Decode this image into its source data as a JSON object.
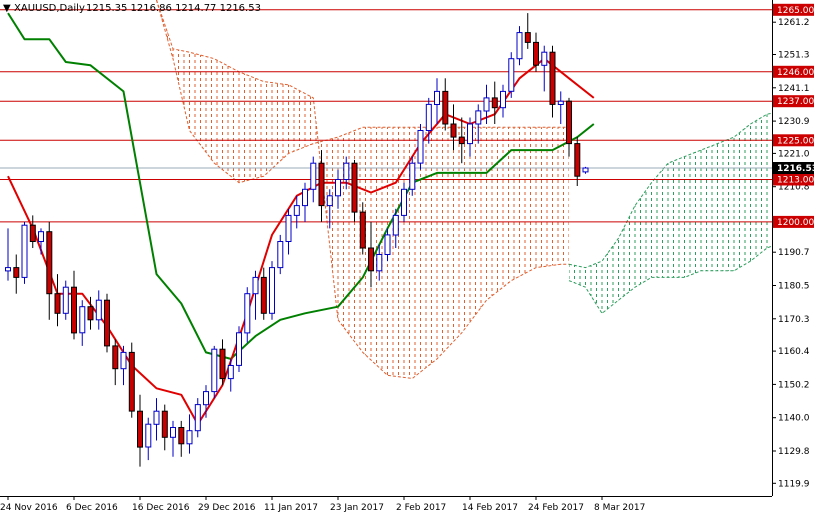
{
  "header": {
    "symbol": "XAUUSD,Daily",
    "ohlc": "1215.35 1216.86 1214.77 1216.53",
    "arrow": "▼"
  },
  "colors": {
    "bull_body": "#ffffff",
    "bull_border": "#0000c8",
    "bear_body": "#c80000",
    "bear_border": "#000000",
    "tenkan": "#e00000",
    "kijun": "#008000",
    "cloud_bear": "#e06030",
    "cloud_bull": "#2e9e5e",
    "level_line": "#cc0000",
    "level_label_bg": "#cc0000",
    "current_label_bg": "#000000"
  },
  "chart_data": {
    "type": "candlestick",
    "ylim": [
      1116,
      1268
    ],
    "grid": false,
    "yticks": [
      1261.2,
      1251.3,
      1241.1,
      1230.9,
      1221.0,
      1210.8,
      1200.6,
      1190.7,
      1180.5,
      1170.3,
      1160.4,
      1150.2,
      1140.0,
      1129.8,
      1119.9
    ],
    "xticks": [
      {
        "label": "24 Nov 2016",
        "i": 0
      },
      {
        "label": "6 Dec 2016",
        "i": 8
      },
      {
        "label": "16 Dec 2016",
        "i": 16
      },
      {
        "label": "29 Dec 2016",
        "i": 24
      },
      {
        "label": "11 Jan 2017",
        "i": 32
      },
      {
        "label": "23 Jan 2017",
        "i": 40
      },
      {
        "label": "2 Feb 2017",
        "i": 48
      },
      {
        "label": "14 Feb 2017",
        "i": 56
      },
      {
        "label": "24 Feb 2017",
        "i": 64
      },
      {
        "label": "8 Mar 2017",
        "i": 72
      }
    ],
    "levels": [
      {
        "value": 1265.0,
        "label": "1265.00"
      },
      {
        "value": 1246.0,
        "label": "1246.00"
      },
      {
        "value": 1237.0,
        "label": "1237.00"
      },
      {
        "value": 1225.0,
        "label": "1225.00"
      },
      {
        "value": 1213.0,
        "label": "1213.00"
      },
      {
        "value": 1200.0,
        "label": "1200.00"
      }
    ],
    "current_price": {
      "value": 1216.53,
      "label": "1216.53"
    },
    "candles": [
      [
        1185,
        1198,
        1182,
        1186
      ],
      [
        1186,
        1190,
        1178,
        1183
      ],
      [
        1183,
        1200,
        1181,
        1199
      ],
      [
        1199,
        1202,
        1192,
        1194
      ],
      [
        1194,
        1198,
        1190,
        1197
      ],
      [
        1197,
        1200,
        1170,
        1178
      ],
      [
        1178,
        1184,
        1168,
        1172
      ],
      [
        1172,
        1182,
        1170,
        1180
      ],
      [
        1180,
        1185,
        1164,
        1166
      ],
      [
        1166,
        1176,
        1162,
        1174
      ],
      [
        1174,
        1177,
        1167,
        1170
      ],
      [
        1170,
        1179,
        1167,
        1176
      ],
      [
        1176,
        1178,
        1160,
        1162
      ],
      [
        1162,
        1164,
        1150,
        1155
      ],
      [
        1155,
        1162,
        1150,
        1160
      ],
      [
        1160,
        1163,
        1140,
        1142
      ],
      [
        1142,
        1147,
        1125,
        1131
      ],
      [
        1131,
        1140,
        1127,
        1138
      ],
      [
        1138,
        1146,
        1133,
        1142
      ],
      [
        1142,
        1144,
        1130,
        1134
      ],
      [
        1134,
        1139,
        1128,
        1137
      ],
      [
        1137,
        1139,
        1128,
        1132
      ],
      [
        1132,
        1141,
        1129,
        1136
      ],
      [
        1136,
        1146,
        1134,
        1144
      ],
      [
        1144,
        1150,
        1140,
        1148
      ],
      [
        1148,
        1162,
        1146,
        1161
      ],
      [
        1161,
        1164,
        1150,
        1152
      ],
      [
        1152,
        1158,
        1148,
        1156
      ],
      [
        1156,
        1168,
        1154,
        1166
      ],
      [
        1166,
        1180,
        1163,
        1178
      ],
      [
        1178,
        1185,
        1170,
        1183
      ],
      [
        1183,
        1186,
        1170,
        1172
      ],
      [
        1172,
        1188,
        1170,
        1186
      ],
      [
        1186,
        1196,
        1184,
        1194
      ],
      [
        1194,
        1204,
        1190,
        1202
      ],
      [
        1202,
        1208,
        1198,
        1205
      ],
      [
        1205,
        1212,
        1200,
        1210
      ],
      [
        1210,
        1220,
        1206,
        1218
      ],
      [
        1218,
        1222,
        1200,
        1205
      ],
      [
        1205,
        1210,
        1198,
        1208
      ],
      [
        1208,
        1216,
        1204,
        1213
      ],
      [
        1213,
        1220,
        1210,
        1218
      ],
      [
        1218,
        1219,
        1200,
        1203
      ],
      [
        1203,
        1206,
        1190,
        1192
      ],
      [
        1192,
        1200,
        1180,
        1185
      ],
      [
        1185,
        1193,
        1182,
        1190
      ],
      [
        1190,
        1198,
        1188,
        1196
      ],
      [
        1196,
        1204,
        1192,
        1202
      ],
      [
        1202,
        1212,
        1200,
        1210
      ],
      [
        1210,
        1220,
        1208,
        1218
      ],
      [
        1218,
        1230,
        1216,
        1228
      ],
      [
        1228,
        1238,
        1224,
        1236
      ],
      [
        1236,
        1244,
        1230,
        1240
      ],
      [
        1240,
        1244,
        1228,
        1230
      ],
      [
        1230,
        1236,
        1222,
        1226
      ],
      [
        1226,
        1232,
        1218,
        1224
      ],
      [
        1224,
        1232,
        1220,
        1230
      ],
      [
        1230,
        1236,
        1224,
        1234
      ],
      [
        1234,
        1242,
        1230,
        1238
      ],
      [
        1238,
        1243,
        1230,
        1235
      ],
      [
        1235,
        1242,
        1232,
        1240
      ],
      [
        1240,
        1252,
        1238,
        1250
      ],
      [
        1250,
        1260,
        1248,
        1258
      ],
      [
        1258,
        1264,
        1253,
        1255
      ],
      [
        1255,
        1258,
        1246,
        1248
      ],
      [
        1248,
        1254,
        1240,
        1252
      ],
      [
        1252,
        1254,
        1232,
        1236
      ],
      [
        1236,
        1240,
        1230,
        1237
      ],
      [
        1237,
        1238,
        1220,
        1224
      ],
      [
        1224,
        1226,
        1211,
        1214
      ],
      [
        1215.35,
        1216.86,
        1214.77,
        1216.53
      ]
    ],
    "tenkan_x": [
      0,
      3,
      6,
      9,
      12,
      15,
      18,
      21,
      23,
      26,
      29,
      32,
      35,
      38,
      41,
      44,
      47,
      50,
      53,
      56,
      59,
      62,
      65,
      68,
      71
    ],
    "tenkan": [
      1214,
      1198,
      1178,
      1178,
      1168,
      1156,
      1149,
      1147,
      1138,
      1150,
      1172,
      1196,
      1208,
      1212,
      1212,
      1209,
      1212,
      1224,
      1233,
      1230,
      1233,
      1244,
      1250,
      1244,
      1238
    ],
    "kijun_x": [
      0,
      2,
      5,
      7,
      10,
      14,
      18,
      21,
      24,
      27,
      30,
      33,
      36,
      40,
      43,
      46,
      49,
      52,
      55,
      58,
      61,
      63,
      66,
      69,
      71
    ],
    "kijun": [
      1264,
      1256,
      1256,
      1249,
      1248,
      1240,
      1184,
      1175,
      1160,
      1158,
      1165,
      1170,
      1172,
      1174,
      1183,
      1198,
      1212,
      1215,
      1215,
      1215,
      1222,
      1222,
      1222,
      1226,
      1230
    ],
    "cloud_bear": {
      "x": [
        18,
        20,
        22,
        25,
        28,
        31,
        34,
        37,
        40,
        43,
        46,
        49,
        52,
        55,
        58,
        61,
        64,
        67,
        68
      ],
      "span_a": [
        1268,
        1250,
        1228,
        1218,
        1212,
        1214,
        1221,
        1224,
        1226,
        1229,
        1229,
        1229,
        1229,
        1229,
        1229,
        1229,
        1229,
        1229,
        1229
      ],
      "span_b": [
        1268,
        1253,
        1252,
        1250,
        1246,
        1243,
        1242,
        1238,
        1170,
        1160,
        1153,
        1152,
        1158,
        1166,
        1176,
        1182,
        1186,
        1187,
        1187
      ]
    },
    "cloud_bull": {
      "x": [
        68,
        70,
        72,
        74,
        76,
        78,
        80,
        82,
        84,
        86,
        88,
        90,
        92,
        94,
        96
      ],
      "span_a": [
        1187,
        1186,
        1188,
        1195,
        1205,
        1212,
        1218,
        1220,
        1222,
        1224,
        1226,
        1230,
        1233,
        1234,
        1234
      ],
      "span_b": [
        1182,
        1180,
        1172,
        1176,
        1180,
        1183,
        1183,
        1183,
        1185,
        1185,
        1185,
        1188,
        1192,
        1194,
        1196
      ]
    }
  }
}
